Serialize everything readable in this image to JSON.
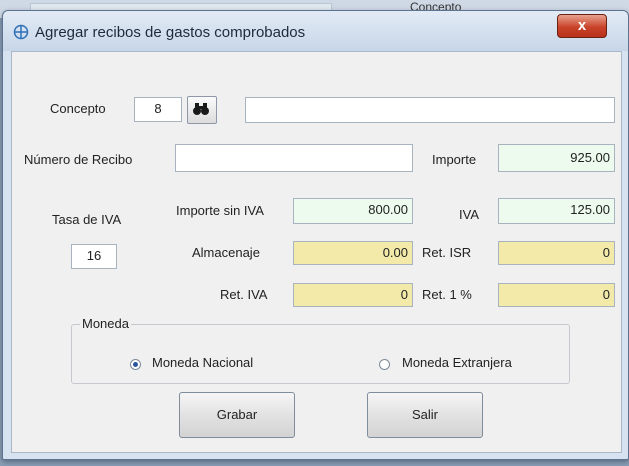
{
  "background": {
    "header_text": "Concepto"
  },
  "window": {
    "title": "Agregar recibos de gastos comprobados",
    "close_label": "x"
  },
  "form": {
    "concepto_label": "Concepto",
    "concepto_code": "8",
    "concepto_desc": "",
    "numero_recibo_label": "Número de Recibo",
    "numero_recibo_value": "",
    "importe_label": "Importe",
    "importe_value": "925.00",
    "tasa_iva_label": "Tasa de IVA",
    "tasa_iva_value": "16",
    "importe_sin_iva_label": "Importe sin IVA",
    "importe_sin_iva_value": "800.00",
    "iva_label": "IVA",
    "iva_value": "125.00",
    "almacenaje_label": "Almacenaje",
    "almacenaje_value": "0.00",
    "ret_isr_label": "Ret. ISR",
    "ret_isr_value": "0",
    "ret_iva_label": "Ret. IVA",
    "ret_iva_value": "0",
    "ret_1_label": "Ret. 1 %",
    "ret_1_value": "0"
  },
  "moneda": {
    "title": "Moneda",
    "options": [
      {
        "label": "Moneda Nacional",
        "selected": true
      },
      {
        "label": "Moneda Extranjera",
        "selected": false
      }
    ]
  },
  "buttons": {
    "grabar": "Grabar",
    "salir": "Salir"
  },
  "colors": {
    "green_field": "#ecfbee",
    "yellow_field": "#f3eaaa",
    "title_bar": "#c7d6e8"
  }
}
